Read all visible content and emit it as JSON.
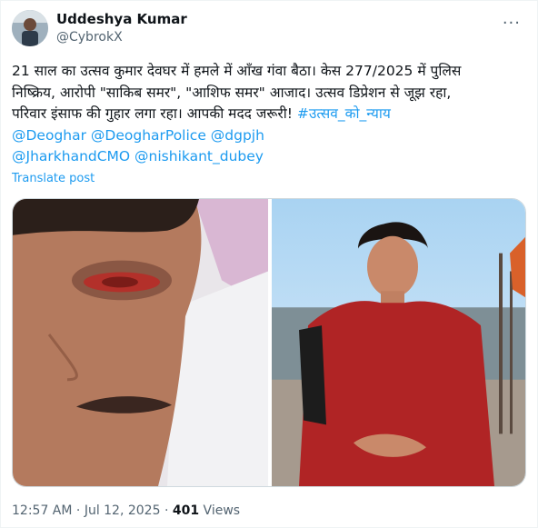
{
  "author": {
    "name": "Uddeshya Kumar",
    "handle": "@CybrokX"
  },
  "more_label": "···",
  "tweet": {
    "line1": "21 साल का उत्सव कुमार देवघर में हमले में आँख गंवा बैठा। केस 277/2025 में पुलिस",
    "line2": "निष्क्रिय, आरोपी  \"साकिब समर\", \"आशिफ समर\" आजाद। उत्सव डिप्रेशन से जूझ रहा,",
    "line3_text": "परिवार इंसाफ की गुहार लगा रहा। आपकी मदद जरूरी! ",
    "hashtag": "#उत्सव_को_न्याय",
    "mentions_line1": "@Deoghar @DeogharPolice @dgpjh",
    "mentions_line2": "@JharkhandCMO @nishikant_dubey"
  },
  "translate_label": "Translate post",
  "meta": {
    "time": "12:57 AM",
    "sep1": " · ",
    "date": "Jul 12, 2025",
    "sep2": " · ",
    "views_count": "401",
    "views_label": " Views"
  },
  "colors": {
    "link": "#1d9bf0",
    "secondary": "#536471",
    "text": "#0f1419"
  }
}
